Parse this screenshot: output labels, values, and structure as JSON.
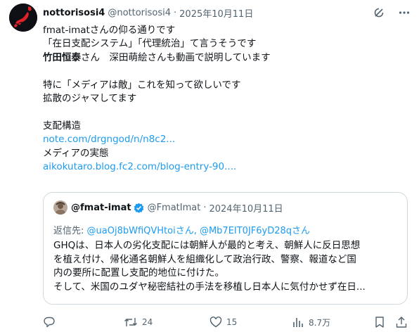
{
  "author": {
    "name": "nottorisosi4",
    "handle": "@nottorisosi4",
    "separator": "·",
    "date": "2025年10月11日"
  },
  "tweet": {
    "line1": "fmat-imatさんの仰る通りです",
    "line2": "「在日支配システム」「代理統治」て言うそうです",
    "line3_bold": "竹田恒泰",
    "line3_rest": "さん　深田萌絵さんも動画で説明しています",
    "line5": "特に「メディアは敵」これを知って欲しいです",
    "line6": "拡散のジャマしてます",
    "line8": "支配構造",
    "link1": "note.com/drgngod/n/n8c2...",
    "line10": "メディアの実態",
    "link2": "aikokutaro.blog.fc2.com/blog-entry-90...."
  },
  "quote": {
    "name": "@fmat-imat",
    "handle": "@FmatImat",
    "separator": "·",
    "date": "2024年10月11日",
    "reply_prefix": "返信先: ",
    "reply_mentions": "@uaOj8bWfiQVHtoiさん, @Mb7EIT0JF6yD28qさん",
    "lines": [
      "GHQは、日本人の劣化支配には朝鮮人が最的と考え、朝鮮人に反日思想",
      "を植え付け、帰化通名朝鮮人を組織化して政治行政、警察、報道など国",
      "内の要所に配置し支配的地位に付けた。",
      "そして、米国のユダヤ秘密結社の手法を移植し日本人に気付かせず在日..."
    ]
  },
  "actions": {
    "replies": "",
    "retweets": "24",
    "likes": "15",
    "views": "8.7万"
  },
  "colors": {
    "link": "#1d9bf0",
    "muted": "#536471",
    "border": "#cfd9de",
    "avatar_red": "#e0202a"
  },
  "icons": [
    "grok-icon",
    "more-icon",
    "verified-icon",
    "reply-icon",
    "retweet-icon",
    "like-icon",
    "views-icon",
    "bookmark-icon",
    "share-icon"
  ]
}
